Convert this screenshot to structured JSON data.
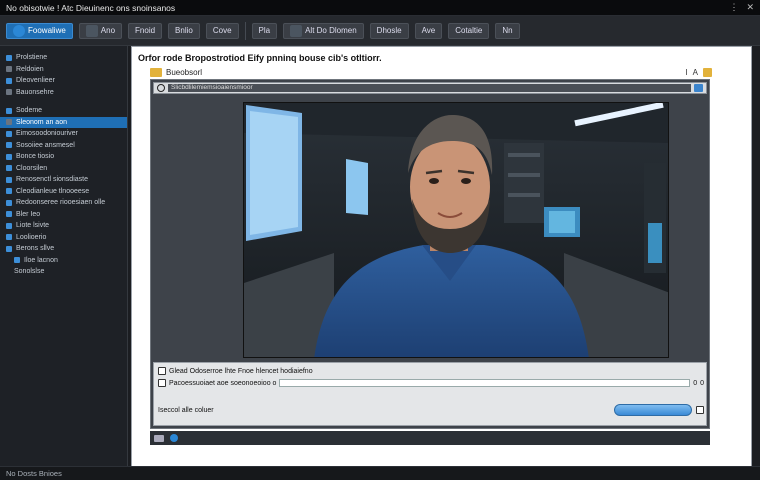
{
  "window": {
    "title": "No obisotwie ! Atc Dieuinenc ons snoinsanos",
    "controls": [
      "⋮",
      "✕"
    ]
  },
  "toolbar": {
    "items": [
      "Foowaliwe",
      "Ano",
      "Fnoid",
      "Bnlio",
      "Cove",
      "Pla",
      "Alt Do Dlomen",
      "Dhosle",
      "Ave",
      "Cotaltie",
      "Nn"
    ]
  },
  "sidebar": {
    "items": [
      {
        "label": "Prolstiene",
        "sub": false
      },
      {
        "label": "Reldoien",
        "sub": false
      },
      {
        "label": "Dleovenlieer",
        "sub": false
      },
      {
        "label": "Bauonsehre",
        "sub": false
      },
      {
        "label": "Sodeme",
        "sub": false
      },
      {
        "label": "Sleonom an aon",
        "sub": false,
        "active": true
      },
      {
        "label": "Eimosoodoniouriver",
        "sub": false
      },
      {
        "label": "Sosoiiee ansmesel",
        "sub": false
      },
      {
        "label": "Bonce tiosio",
        "sub": false
      },
      {
        "label": "Cloorsilen",
        "sub": false
      },
      {
        "label": "Renosenctl sionsdiaste",
        "sub": false
      },
      {
        "label": "Cleodianleue tlnooeese",
        "sub": false
      },
      {
        "label": "Redoonseree riooesiaen olle",
        "sub": false
      },
      {
        "label": "Bler Ieo",
        "sub": false
      },
      {
        "label": "Liote lsivte",
        "sub": false
      },
      {
        "label": "Loolioerio",
        "sub": false
      },
      {
        "label": "Berons sllve",
        "sub": false
      },
      {
        "label": "Iloe lacnon",
        "sub": true
      },
      {
        "label": "Sonolslse",
        "sub": true
      }
    ]
  },
  "panel": {
    "title": "Orfor rode Bropostrotiod Eify pnninq bouse cib's otltiorr.",
    "folder_label": "Bueobsorl",
    "folder_actions": [
      "I",
      "A"
    ],
    "address_value": "Slicbdlilemiemsioaiensmioor"
  },
  "controls": {
    "row1_text": "Glead Odoserroe lhte Fnoe hlencet hodiaiefno",
    "row2_label": "Pacoessuoiaet aoe soeonoeoioo o",
    "row3_label": "Iseccol alle coluer",
    "numbers": [
      "0",
      "0"
    ]
  },
  "status": {
    "text": "No Dosts Bnioes"
  }
}
